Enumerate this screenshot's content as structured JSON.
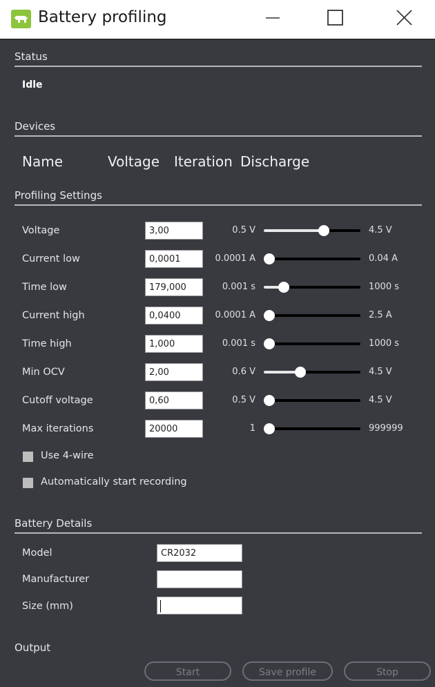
{
  "window": {
    "title": "Battery profiling",
    "app_icon": "bear-icon",
    "app_icon_color": "#8cc43c",
    "controls": [
      "minimize-icon",
      "maximize-icon",
      "close-icon"
    ]
  },
  "status": {
    "section_title": "Status",
    "value": "Idle"
  },
  "devices": {
    "section_title": "Devices",
    "columns": [
      "Name",
      "Voltage",
      "Iteration",
      "Discharge"
    ]
  },
  "profiling": {
    "section_title": "Profiling Settings",
    "rows": [
      {
        "label": "Voltage",
        "value": "3,00",
        "min": "0.5 V",
        "max": "4.5 V",
        "slider_fraction": 0.62
      },
      {
        "label": "Current low",
        "value": "0,0001",
        "min": "0.0001 A",
        "max": "0.04 A",
        "slider_fraction": 0.0
      },
      {
        "label": "Time low",
        "value": "179,000",
        "min": "0.001 s",
        "max": "1000 s",
        "slider_fraction": 0.21
      },
      {
        "label": "Current high",
        "value": "0,0400",
        "min": "0.0001 A",
        "max": "2.5 A",
        "slider_fraction": 0.0
      },
      {
        "label": "Time high",
        "value": "1,000",
        "min": "0.001 s",
        "max": "1000 s",
        "slider_fraction": 0.0
      },
      {
        "label": "Min OCV",
        "value": "2,00",
        "min": "0.6 V",
        "max": "4.5 V",
        "slider_fraction": 0.38
      },
      {
        "label": "Cutoff voltage",
        "value": "0,60",
        "min": "0.5 V",
        "max": "4.5 V",
        "slider_fraction": 0.03
      },
      {
        "label": "Max iterations",
        "value": "20000",
        "min": "1",
        "max": "999999",
        "slider_fraction": 0.02
      }
    ],
    "checkboxes": [
      {
        "label": "Use 4-wire",
        "checked": false
      },
      {
        "label": "Automatically start recording",
        "checked": false
      }
    ]
  },
  "battery": {
    "section_title": "Battery Details",
    "fields": [
      {
        "label": "Model",
        "value": "CR2032"
      },
      {
        "label": "Manufacturer",
        "value": ""
      },
      {
        "label": "Size (mm)",
        "value": ""
      }
    ]
  },
  "output": {
    "section_title": "Output",
    "buttons": {
      "start": "Start",
      "save": "Save profile",
      "stop": "Stop"
    }
  }
}
